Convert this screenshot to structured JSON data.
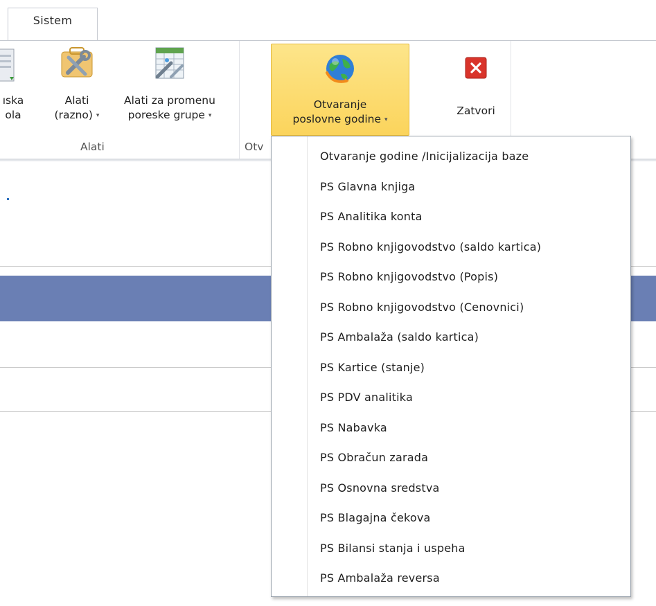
{
  "tabs": [
    {
      "label": "Sistem"
    }
  ],
  "ribbon": {
    "partial_button": {
      "line1": "ıska",
      "line2": "ola"
    },
    "alati_razno": {
      "line1": "Alati",
      "line2": "(razno)"
    },
    "alati_promena": {
      "line1": "Alati za promenu",
      "line2": "poreske grupe"
    },
    "otvaranje": {
      "line1": "Otvaranje",
      "line2": "poslovne godine"
    },
    "zatvori": {
      "label": "Zatvori"
    },
    "groups": {
      "alati": "Alati",
      "otvaranje_partial": "Otv"
    },
    "dropdown_arrow": "▾"
  },
  "menu": {
    "items": [
      {
        "label": "Otvaranje godine /Inicijalizacija baze"
      },
      {
        "label": "PS Glavna knjiga"
      },
      {
        "label": "PS Analitika konta"
      },
      {
        "label": "PS Robno knjigovodstvo (saldo kartica)"
      },
      {
        "label": "PS Robno knjigovodstvo (Popis)"
      },
      {
        "label": "PS Robno knjigovodstvo (Cenovnici)"
      },
      {
        "label": "PS Ambalaža (saldo kartica)"
      },
      {
        "label": "PS Kartice (stanje)"
      },
      {
        "label": "PS PDV analitika"
      },
      {
        "label": "PS Nabavka"
      },
      {
        "label": "PS Obračun zarada"
      },
      {
        "label": "PS Osnovna sredstva"
      },
      {
        "label": "PS Blagajna čekova"
      },
      {
        "label": "PS Bilansi stanja i uspeha"
      },
      {
        "label": "PS Ambalaža reversa"
      }
    ]
  },
  "colors": {
    "band": "#6a7fb4",
    "highlight": "#fbd45c",
    "close_red": "#d9342b"
  },
  "icons": [
    "document-icon",
    "tools-icon",
    "spreadsheet-tools-icon",
    "globe-icon",
    "close-icon"
  ]
}
